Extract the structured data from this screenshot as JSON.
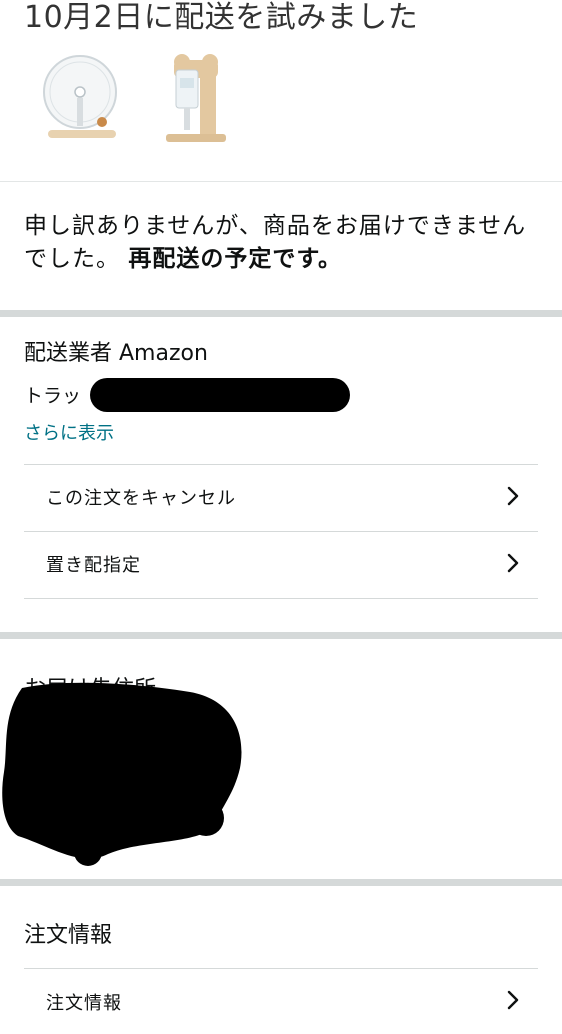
{
  "header": {
    "title": "10月2日に配送を試みました"
  },
  "products": [
    {
      "icon": "hamster-wheel-image"
    },
    {
      "icon": "water-bottle-stand-image"
    }
  ],
  "message": {
    "text": "申し訳ありませんが、商品をお届けできませんでした。",
    "bold": "再配送の予定です。"
  },
  "carrier": {
    "heading": "配送業者 Amazon",
    "tracking_prefix": "トラッ",
    "show_more": "さらに表示"
  },
  "actions": [
    {
      "label": "この注文をキャンセル",
      "icon": "chevron-right-icon"
    },
    {
      "label": "置き配指定",
      "icon": "chevron-right-icon"
    }
  ],
  "address": {
    "heading": "お届け先住所"
  },
  "order": {
    "heading": "注文情報",
    "row_label": "注文情報"
  },
  "colors": {
    "link": "#007185",
    "separator": "#d5d9d9",
    "text": "#0f1111"
  }
}
